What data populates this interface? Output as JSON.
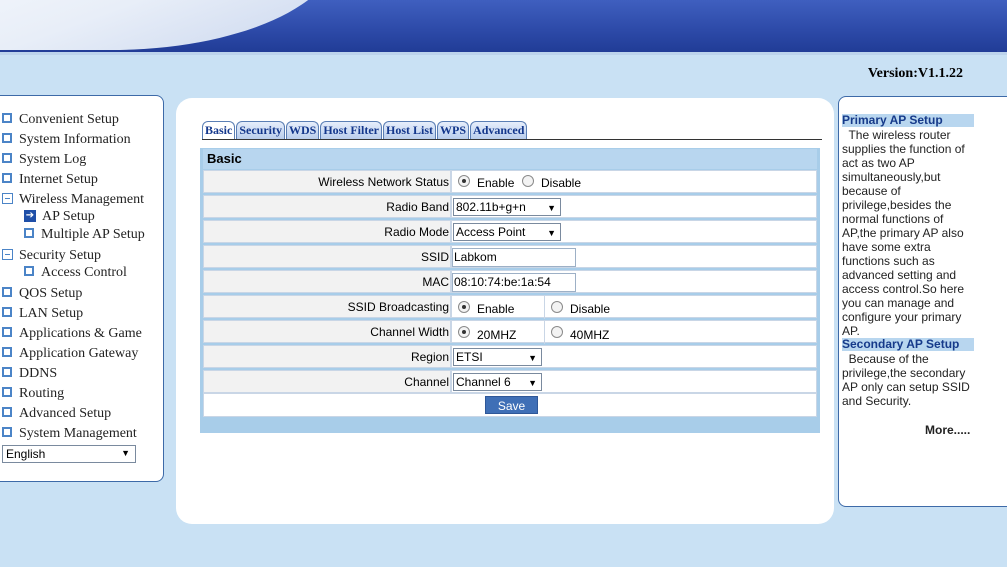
{
  "header": {
    "version": "Version:V1.1.22"
  },
  "nav": {
    "items": [
      {
        "label": "Convenient Setup",
        "icon": "square-icon"
      },
      {
        "label": "System Information",
        "icon": "square-icon"
      },
      {
        "label": "System Log",
        "icon": "square-icon"
      },
      {
        "label": "Internet Setup",
        "icon": "square-icon"
      },
      {
        "label": "Wireless Management",
        "icon": "minus-icon"
      },
      {
        "label": "AP Setup",
        "icon": "arrow-icon"
      },
      {
        "label": "Multiple AP Setup",
        "icon": "square-icon"
      },
      {
        "label": "Security Setup",
        "icon": "minus-icon"
      },
      {
        "label": "Access Control",
        "icon": "square-icon"
      },
      {
        "label": "QOS Setup",
        "icon": "square-icon"
      },
      {
        "label": "LAN Setup",
        "icon": "square-icon"
      },
      {
        "label": "Applications & Game",
        "icon": "square-icon"
      },
      {
        "label": "Application Gateway",
        "icon": "square-icon"
      },
      {
        "label": "DDNS",
        "icon": "square-icon"
      },
      {
        "label": "Routing",
        "icon": "square-icon"
      },
      {
        "label": "Advanced Setup",
        "icon": "square-icon"
      },
      {
        "label": "System Management",
        "icon": "square-icon"
      }
    ],
    "language": "English"
  },
  "tabs": [
    "Basic",
    "Security",
    "WDS",
    "Host Filter",
    "Host List",
    "WPS",
    "Advanced"
  ],
  "form": {
    "title": "Basic",
    "wireless_status": {
      "label": "Wireless Network Status",
      "opt1": "Enable",
      "opt2": "Disable",
      "selected": "Enable"
    },
    "radio_band": {
      "label": "Radio Band",
      "value": "802.11b+g+n"
    },
    "radio_mode": {
      "label": "Radio Mode",
      "value": "Access Point"
    },
    "ssid": {
      "label": "SSID",
      "value": "Labkom"
    },
    "mac": {
      "label": "MAC",
      "value": "08:10:74:be:1a:54"
    },
    "ssid_broadcasting": {
      "label": "SSID Broadcasting",
      "opt1": "Enable",
      "opt2": "Disable",
      "selected": "Enable"
    },
    "channel_width": {
      "label": "Channel Width",
      "opt1": "20MHZ",
      "opt2": "40MHZ",
      "selected": "20MHZ"
    },
    "region": {
      "label": "Region",
      "value": "ETSI"
    },
    "channel": {
      "label": "Channel",
      "value": "Channel 6"
    },
    "save_label": "Save"
  },
  "help": {
    "primary_title": "Primary AP Setup",
    "primary_lines": [
      "  The wireless router",
      "supplies the function of",
      "act as two AP",
      "simultaneously,but",
      "because of",
      "privilege,besides the",
      "normal functions of",
      "AP,the primary AP also",
      "have some extra",
      "functions such as",
      "advanced setting and",
      "access control.So here",
      "you can manage and",
      "configure your primary",
      "AP."
    ],
    "secondary_title": "Secondary AP Setup",
    "secondary_lines": [
      "  Because of the",
      "privilege,the secondary",
      "AP only can setup SSID",
      "and Security."
    ],
    "more": "More....."
  }
}
